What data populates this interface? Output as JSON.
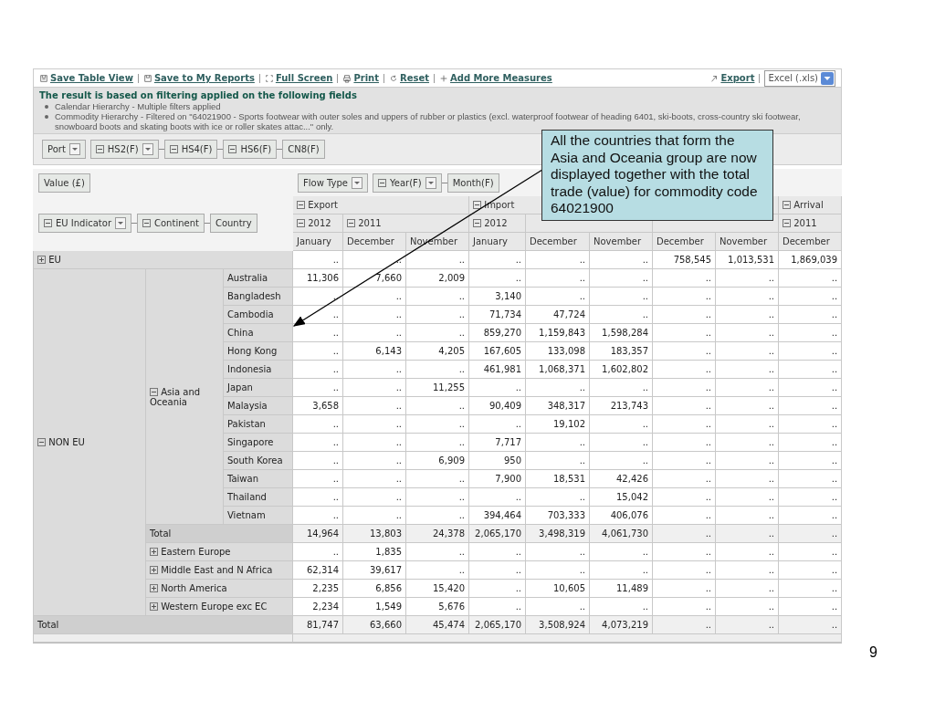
{
  "toolbar": {
    "links": [
      {
        "label": "Save Table View"
      },
      {
        "label": "Save to My Reports"
      },
      {
        "label": "Full Screen"
      },
      {
        "label": "Print"
      },
      {
        "label": "Reset"
      },
      {
        "label": "Add More Measures"
      }
    ],
    "export": {
      "label": "Export"
    },
    "format_select": {
      "value": "Excel (.xls)"
    }
  },
  "filter_panel": {
    "title": "The result is based on filtering applied on the following fields",
    "bullets": [
      "Calendar Hierarchy - Multiple filters applied",
      "Commodity Hierarchy - Filtered on \"64021900 - Sports footwear with outer soles and uppers of rubber or plastics (excl. waterproof footwear of heading 6401, ski-boots, cross-country ski footwear, snowboard boots and skating boots with ice or roller skates attac...\" only."
    ]
  },
  "filter_fields": [
    {
      "label": "Port",
      "dropdown": true,
      "linked": false
    },
    {
      "label": "HS2(F)",
      "expanded": true,
      "dropdown": true,
      "linked": false
    },
    {
      "label": "HS4(F)",
      "expanded": true,
      "dropdown": false,
      "linked": true
    },
    {
      "label": "HS6(F)",
      "expanded": true,
      "dropdown": false,
      "linked": true
    },
    {
      "label": "CN8(F)",
      "dropdown": false,
      "linked": true
    }
  ],
  "pivot": {
    "measure": "Value (£)",
    "column_fields": [
      {
        "label": "Flow Type",
        "dropdown": true,
        "linked": false
      },
      {
        "label": "Year(F)",
        "expanded": true,
        "dropdown": true,
        "linked": false
      },
      {
        "label": "Month(F)",
        "dropdown": false,
        "linked": true
      }
    ],
    "row_fields": [
      {
        "label": "EU Indicator",
        "expanded": true,
        "dropdown": true,
        "linked": false
      },
      {
        "label": "Continent",
        "expanded": true,
        "dropdown": false,
        "linked": true
      },
      {
        "label": "Country",
        "dropdown": false,
        "linked": true
      }
    ],
    "columns": [
      {
        "label": "Export",
        "expanded": true,
        "years": [
          {
            "label": "2012",
            "expanded": true,
            "months": [
              "January"
            ]
          },
          {
            "label": "2011",
            "expanded": true,
            "months": [
              "December",
              "November"
            ]
          }
        ]
      },
      {
        "label": "Import",
        "expanded": true,
        "years": [
          {
            "label": "2012",
            "expanded": true,
            "months": [
              "January"
            ]
          },
          {
            "months": [
              "December",
              "November"
            ]
          }
        ]
      },
      {
        "years": [
          {
            "months": [
              "December",
              "November"
            ]
          }
        ]
      },
      {
        "label": "Arrival",
        "expanded": true,
        "years": [
          {
            "label": "2011",
            "expanded": true,
            "months": [
              "December"
            ]
          }
        ]
      }
    ],
    "row_groups": [
      {
        "label": "EU",
        "expanded": false,
        "values": [
          "..",
          "..",
          "..",
          "..",
          "..",
          "..",
          "758,545",
          "1,013,531",
          "1,869,039"
        ]
      },
      {
        "label": "NON EU",
        "expanded": true,
        "children": [
          {
            "label": "Asia and Oceania",
            "expanded": true,
            "children": [
              {
                "label": "Australia",
                "values": [
                  "11,306",
                  "7,660",
                  "2,009",
                  "..",
                  "..",
                  "..",
                  "..",
                  "..",
                  ".."
                ]
              },
              {
                "label": "Bangladesh",
                "values": [
                  "..",
                  "..",
                  "..",
                  "3,140",
                  "..",
                  "..",
                  "..",
                  "..",
                  ".."
                ]
              },
              {
                "label": "Cambodia",
                "values": [
                  "..",
                  "..",
                  "..",
                  "71,734",
                  "47,724",
                  "..",
                  "..",
                  "..",
                  ".."
                ]
              },
              {
                "label": "China",
                "values": [
                  "..",
                  "..",
                  "..",
                  "859,270",
                  "1,159,843",
                  "1,598,284",
                  "..",
                  "..",
                  ".."
                ]
              },
              {
                "label": "Hong Kong",
                "values": [
                  "..",
                  "6,143",
                  "4,205",
                  "167,605",
                  "133,098",
                  "183,357",
                  "..",
                  "..",
                  ".."
                ]
              },
              {
                "label": "Indonesia",
                "values": [
                  "..",
                  "..",
                  "..",
                  "461,981",
                  "1,068,371",
                  "1,602,802",
                  "..",
                  "..",
                  ".."
                ]
              },
              {
                "label": "Japan",
                "values": [
                  "..",
                  "..",
                  "11,255",
                  "..",
                  "..",
                  "..",
                  "..",
                  "..",
                  ".."
                ]
              },
              {
                "label": "Malaysia",
                "values": [
                  "3,658",
                  "..",
                  "..",
                  "90,409",
                  "348,317",
                  "213,743",
                  "..",
                  "..",
                  ".."
                ]
              },
              {
                "label": "Pakistan",
                "values": [
                  "..",
                  "..",
                  "..",
                  "..",
                  "19,102",
                  "..",
                  "..",
                  "..",
                  ".."
                ]
              },
              {
                "label": "Singapore",
                "values": [
                  "..",
                  "..",
                  "..",
                  "7,717",
                  "..",
                  "..",
                  "..",
                  "..",
                  ".."
                ]
              },
              {
                "label": "South Korea",
                "values": [
                  "..",
                  "..",
                  "6,909",
                  "950",
                  "..",
                  "..",
                  "..",
                  "..",
                  ".."
                ]
              },
              {
                "label": "Taiwan",
                "values": [
                  "..",
                  "..",
                  "..",
                  "7,900",
                  "18,531",
                  "42,426",
                  "..",
                  "..",
                  ".."
                ]
              },
              {
                "label": "Thailand",
                "values": [
                  "..",
                  "..",
                  "..",
                  "..",
                  "..",
                  "15,042",
                  "..",
                  "..",
                  ".."
                ]
              },
              {
                "label": "Vietnam",
                "values": [
                  "..",
                  "..",
                  "..",
                  "394,464",
                  "703,333",
                  "406,076",
                  "..",
                  "..",
                  ".."
                ]
              }
            ],
            "total": {
              "label": "Total",
              "values": [
                "14,964",
                "13,803",
                "24,378",
                "2,065,170",
                "3,498,319",
                "4,061,730",
                "..",
                "..",
                ".."
              ]
            }
          },
          {
            "label": "Eastern Europe",
            "expanded": false,
            "values": [
              "..",
              "1,835",
              "..",
              "..",
              "..",
              "..",
              "..",
              "..",
              ".."
            ]
          },
          {
            "label": "Middle East and N Africa",
            "expanded": false,
            "values": [
              "62,314",
              "39,617",
              "..",
              "..",
              "..",
              "..",
              "..",
              "..",
              ".."
            ]
          },
          {
            "label": "North America",
            "expanded": false,
            "values": [
              "2,235",
              "6,856",
              "15,420",
              "..",
              "10,605",
              "11,489",
              "..",
              "..",
              ".."
            ]
          },
          {
            "label": "Western Europe exc EC",
            "expanded": false,
            "values": [
              "2,234",
              "1,549",
              "5,676",
              "..",
              "..",
              "..",
              "..",
              "..",
              ".."
            ]
          }
        ]
      }
    ],
    "grand_total": {
      "label": "Total",
      "values": [
        "81,747",
        "63,660",
        "45,474",
        "2,065,170",
        "3,508,924",
        "4,073,219",
        "..",
        "..",
        ".."
      ]
    }
  },
  "callout": {
    "text": "All the countries that form the Asia and Oceania group are now displayed together with the total trade (value) for commodity code 64021900"
  },
  "slide_number": "9"
}
